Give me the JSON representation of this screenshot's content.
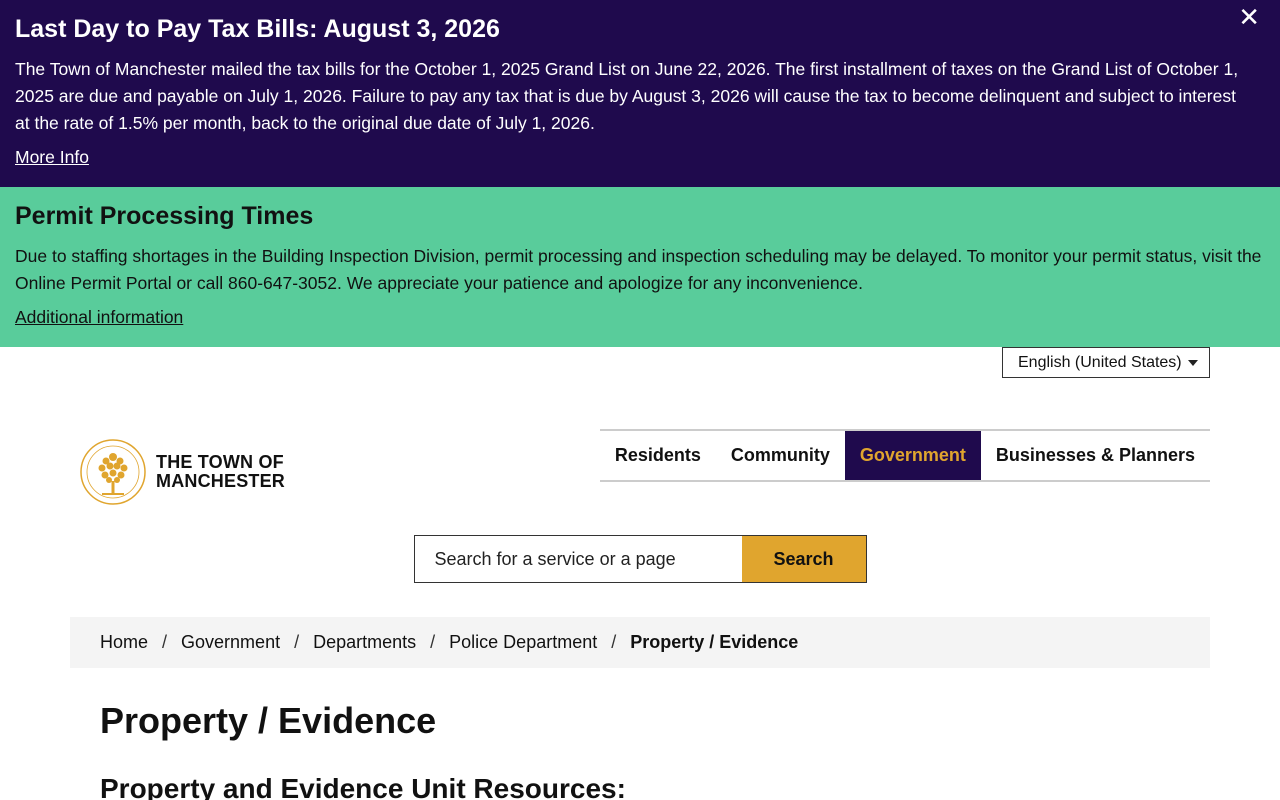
{
  "alerts": {
    "tax": {
      "title": "Last Day to Pay Tax Bills: August 3, 2026",
      "body": "The Town of Manchester mailed the tax bills for the October 1, 2025 Grand List on June 22, 2026. The first installment of taxes on the Grand List of October 1, 2025 are due and payable on July 1, 2026. Failure to pay any tax that is due by August 3, 2026 will cause the tax to become delinquent and subject to interest at the rate of 1.5% per month, back to the original due date of July 1, 2026.",
      "link": "More Info",
      "close": "✕"
    },
    "permit": {
      "title": "Permit Processing Times",
      "body": "Due to staffing shortages in the Building Inspection Division, permit processing and inspection scheduling may be delayed. To monitor your permit status, visit the Online Permit Portal or call 860-647-3052. We appreciate your patience and apologize for any inconvenience.",
      "link": "Additional information"
    }
  },
  "language": {
    "selected": "English (United States)"
  },
  "logo": {
    "line1": "THE TOWN OF",
    "line2": "MANCHESTER"
  },
  "nav": {
    "items": [
      {
        "label": "Residents"
      },
      {
        "label": "Community"
      },
      {
        "label": "Government"
      },
      {
        "label": "Businesses & Planners"
      }
    ]
  },
  "search": {
    "placeholder": "Search for a service or a page",
    "button": "Search"
  },
  "breadcrumb": {
    "items": [
      "Home",
      "Government",
      "Departments",
      "Police Department",
      "Property / Evidence"
    ],
    "separator": "/"
  },
  "page": {
    "title": "Property / Evidence",
    "section": "Property and Evidence Unit Resources:"
  },
  "colors": {
    "tax_alert_bg": "#1f0a4d",
    "permit_alert_bg": "#59cc9b",
    "accent": "#e0a52e"
  }
}
